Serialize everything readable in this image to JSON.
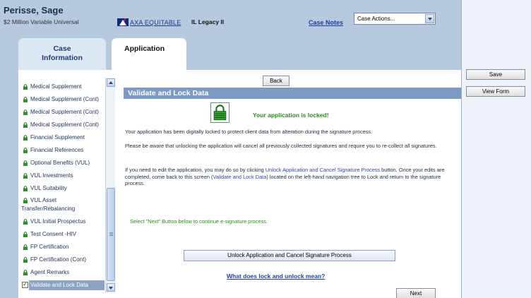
{
  "header": {
    "case_name": "Perisse, Sage",
    "case_subtitle": "$2 Million Variable Universal",
    "logo_text": "AXA EQUITABLE",
    "product": "IL Legacy II",
    "case_notes": "Case Notes",
    "case_actions_value": "Case Actions..."
  },
  "tabs": {
    "case_info_line1": "Case",
    "case_info_line2": "Information",
    "application": "Application"
  },
  "nav": {
    "items": [
      "Medical Supplement",
      "Medical Supplement (Cont)",
      "Medical Supplement (Cont)",
      "Medical Supplement (Cont)",
      "Financial Supplement",
      "Financial References",
      "Optional Benefits (VUL)",
      "VUL Investments",
      "VUL Suitability",
      "VUL Asset",
      "VUL Initial Prospectus",
      "Test Consent -HIV",
      "FP Certification",
      "FP Certification (Cont)",
      "Agent Remarks",
      "Validate and Lock Data"
    ],
    "asset_line2": "Transfer/Rebalancing"
  },
  "panel": {
    "back": "Back",
    "section_title": "Validate and Lock Data",
    "locked_message": "Your application is locked!",
    "para1": "Your application has been digitally locked to protect client data from alteration during the signature process.",
    "para2": "Please be aware that unlocking the application will cancel all previously collected signatures and require you to re-collect all signatures.",
    "para3_a": "If you need to edit the application, you may do so by clicking ",
    "para3_link1": "Unlock Application and Cancel Signature Process",
    "para3_b": " button. Once your edits are completed, come back to this screen (",
    "para3_link2": "Validate and Lock Data",
    "para3_c": ") located on the left-hand navigation tree to Lock and return to the signature process.",
    "select_next": "Select \"Next\" Button below to continue e-signature process.",
    "unlock_button": "Unlock Application and Cancel Signature Process",
    "what_does": "What does lock and unlock mean?",
    "next": "Next"
  },
  "side": {
    "save": "Save",
    "view_form": "View Form"
  },
  "colors": {
    "frame_blue": "#4a7fb8",
    "section_bar": "#7d9ac3",
    "locked_green": "#2b8a1d",
    "link_blue": "#1f3f9c"
  },
  "icons": {
    "nav_item": "lock-icon",
    "selected_item": "checkbox-icon",
    "locked_status": "padlock-icon"
  }
}
